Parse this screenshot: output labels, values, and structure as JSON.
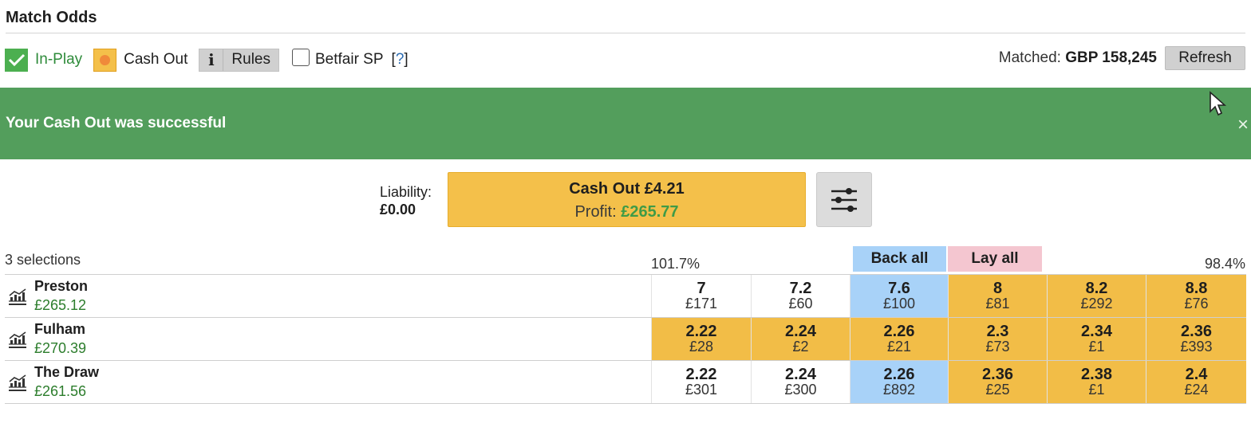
{
  "market": {
    "title": "Match Odds"
  },
  "toolbar": {
    "inplay_label": "In-Play",
    "cashout_label": "Cash Out",
    "info_label": "i",
    "rules_label": "Rules",
    "sp_label": "Betfair SP",
    "help_open": "[",
    "help_q": "?",
    "help_close": "]",
    "matched_label": "Matched:",
    "matched_value": "GBP 158,245",
    "refresh_label": "Refresh"
  },
  "banner": {
    "message": "Your Cash Out was successful",
    "close": "×",
    "color": "#539e5c"
  },
  "cashout": {
    "liability_label": "Liability:",
    "liability_value": "£0.00",
    "button_label": "Cash Out £4.21",
    "profit_label": "Profit:",
    "profit_value": "£265.77",
    "color": "#f4c04a"
  },
  "grid": {
    "selections_label": "3 selections",
    "back_percent": "101.7%",
    "lay_percent": "98.4%",
    "back_all_label": "Back all",
    "lay_all_label": "Lay all",
    "colors": {
      "back": "#a8d2f8",
      "lay": "#f4c6d0",
      "highlight": "#f2bd47"
    },
    "runners": [
      {
        "name": "Preston",
        "pl": "£265.12",
        "cells": [
          {
            "price": "7",
            "size": "£171",
            "style": "white"
          },
          {
            "price": "7.2",
            "size": "£60",
            "style": "white"
          },
          {
            "price": "7.6",
            "size": "£100",
            "style": "blue"
          },
          {
            "price": "8",
            "size": "£81",
            "style": "gold"
          },
          {
            "price": "8.2",
            "size": "£292",
            "style": "gold"
          },
          {
            "price": "8.8",
            "size": "£76",
            "style": "gold"
          }
        ]
      },
      {
        "name": "Fulham",
        "pl": "£270.39",
        "cells": [
          {
            "price": "2.22",
            "size": "£28",
            "style": "gold"
          },
          {
            "price": "2.24",
            "size": "£2",
            "style": "gold"
          },
          {
            "price": "2.26",
            "size": "£21",
            "style": "gold"
          },
          {
            "price": "2.3",
            "size": "£73",
            "style": "gold"
          },
          {
            "price": "2.34",
            "size": "£1",
            "style": "gold"
          },
          {
            "price": "2.36",
            "size": "£393",
            "style": "gold"
          }
        ]
      },
      {
        "name": "The Draw",
        "pl": "£261.56",
        "cells": [
          {
            "price": "2.22",
            "size": "£301",
            "style": "white"
          },
          {
            "price": "2.24",
            "size": "£300",
            "style": "white"
          },
          {
            "price": "2.26",
            "size": "£892",
            "style": "blue"
          },
          {
            "price": "2.36",
            "size": "£25",
            "style": "gold"
          },
          {
            "price": "2.38",
            "size": "£1",
            "style": "gold"
          },
          {
            "price": "2.4",
            "size": "£24",
            "style": "gold"
          }
        ]
      }
    ]
  },
  "icons": {
    "inplay": "check-icon",
    "cashout": "cashout-dot-icon",
    "settings": "sliders-icon",
    "runner_chart": "chart-icon",
    "banner_close": "close-icon",
    "cursor": "mouse-cursor-icon"
  }
}
